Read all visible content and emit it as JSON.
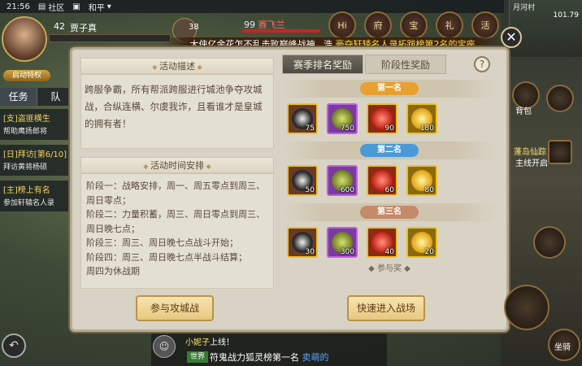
{
  "status_bar": {
    "time": "21:56",
    "community": "社区",
    "peace": "和平"
  },
  "player": {
    "level": "42",
    "name": "贾子真",
    "auto_label": "启动特权"
  },
  "pet": {
    "count": "38"
  },
  "target": {
    "level": "99",
    "name": "赛飞兰"
  },
  "top_icons": [
    "Hi",
    "府",
    "宝",
    "礼",
    "活"
  ],
  "minimap": {
    "location": "月河村",
    "coord": "101.79"
  },
  "left_tabs": [
    "任务",
    "队"
  ],
  "quests": [
    {
      "title": "[支]盗匪横生",
      "detail": "帮助鹰扬郎将"
    },
    {
      "title": "[日]拜访[第6/10]",
      "detail": "拜访黄将杨硕"
    },
    {
      "title": "[主]榜上有名",
      "detail": "参加轩辕名人录"
    }
  ],
  "marquee": {
    "pre": "大侠亿余花怎不乱击败巅峰战神...浩",
    "highlight": "豪夺轩辕名人录拓跋榜第2名的宝座"
  },
  "close_label": "✕",
  "panel": {
    "desc_title": "活动描述",
    "desc_text": "跨服争霸，所有帮派跨服进行城池争夺攻城战，合纵连横、尔虞我诈，且看谁才是皇城的拥有者！",
    "time_title": "活动时间安排",
    "schedule": [
      "阶段一：战略安排，周一、周五零点到周三、周日零点；",
      "阶段二：力量积蓄，周三、周日零点到周三、周日晚七点；",
      "阶段三：周三、周日晚七点战斗开始；",
      "阶段四：周三、周日晚七点半战斗结算；",
      "周四为休战期"
    ],
    "tab_season": "赛季排名奖励",
    "tab_stage": "阶段性奖励",
    "help": "?",
    "ranks": [
      {
        "label": "第一名",
        "color": "#e8a030",
        "items": [
          "75",
          "750",
          "90",
          "180"
        ]
      },
      {
        "label": "第二名",
        "color": "#4a9ad8",
        "items": [
          "50",
          "600",
          "60",
          "80"
        ]
      },
      {
        "label": "第三名",
        "color": "#c48a6a",
        "items": [
          "30",
          "300",
          "40",
          "20"
        ]
      }
    ],
    "participation": "参与奖",
    "btn_join": "参与攻城战",
    "btn_enter": "快速进入战场"
  },
  "chat": {
    "line1_name": "小妮子",
    "line1_text": "上线！",
    "channel": "世界",
    "line2_text": "符鬼战力狐灵榜第一名",
    "line2_name": "卖萌的"
  },
  "right_side": {
    "island": "蓬岛仙踪",
    "island_sub": "主线开启",
    "bag": "背包",
    "mount": "坐骑"
  }
}
